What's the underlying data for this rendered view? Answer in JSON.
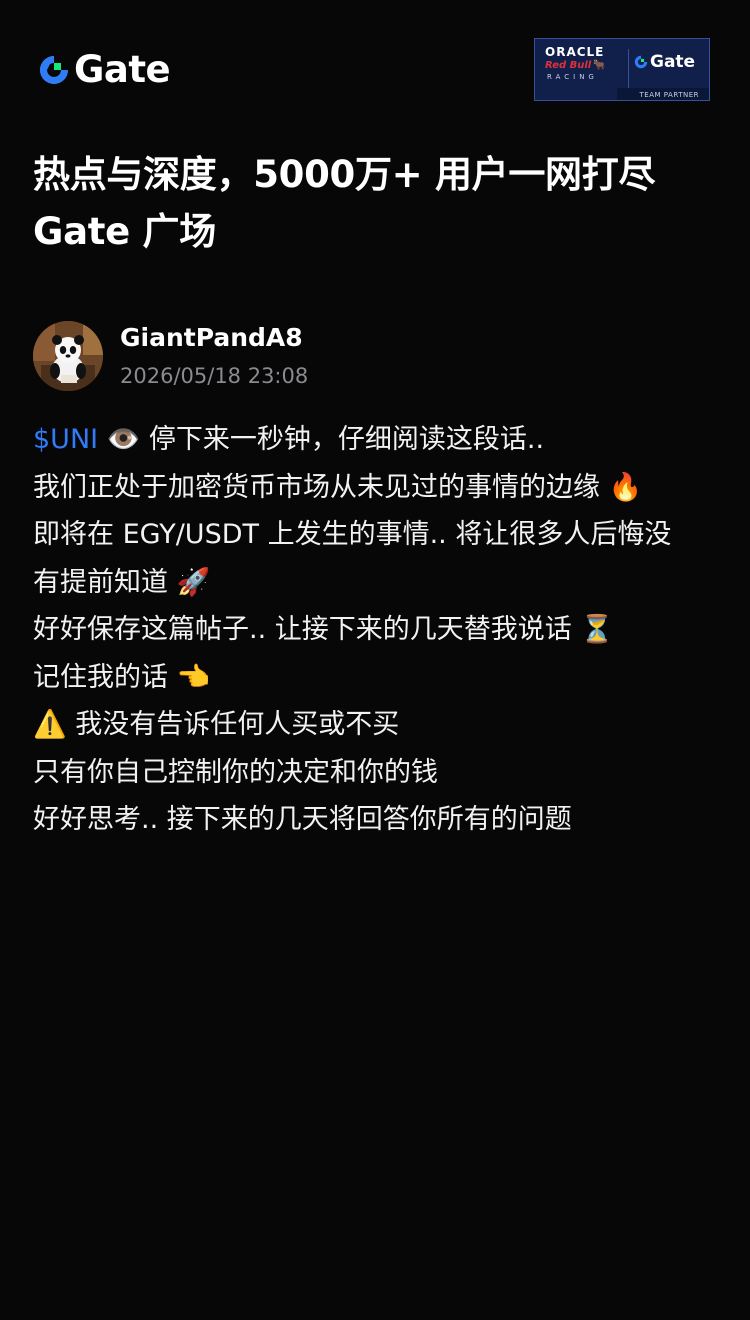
{
  "brand": {
    "name": "Gate",
    "accent": "#2f7cf6",
    "mark_green": "#17e87a"
  },
  "partner_badge": {
    "oracle": "ORACLE",
    "redbull": "Red Bull",
    "racing": "RACING",
    "gate": "Gate",
    "team_partner": "TEAM PARTNER"
  },
  "headline": {
    "line1": "热点与深度，5000万+ 用户一网打尽",
    "line2": "Gate 广场"
  },
  "author": {
    "username": "GiantPandA8",
    "timestamp": "2026/05/18 23:08"
  },
  "post": {
    "ticker": "$UNI",
    "lines": [
      " 👁️ 停下来一秒钟，仔细阅读这段话..",
      "我们正处于加密货币市场从未见过的事情的边缘 🔥",
      "即将在 EGY/USDT 上发生的事情.. 将让很多人后悔没",
      "有提前知道 🚀",
      "好好保存这篇帖子.. 让接下来的几天替我说话 ⏳",
      "记住我的话 👈",
      "⚠️ 我没有告诉任何人买或不买",
      "只有你自己控制你的决定和你的钱",
      "好好思考.. 接下来的几天将回答你所有的问题"
    ]
  }
}
